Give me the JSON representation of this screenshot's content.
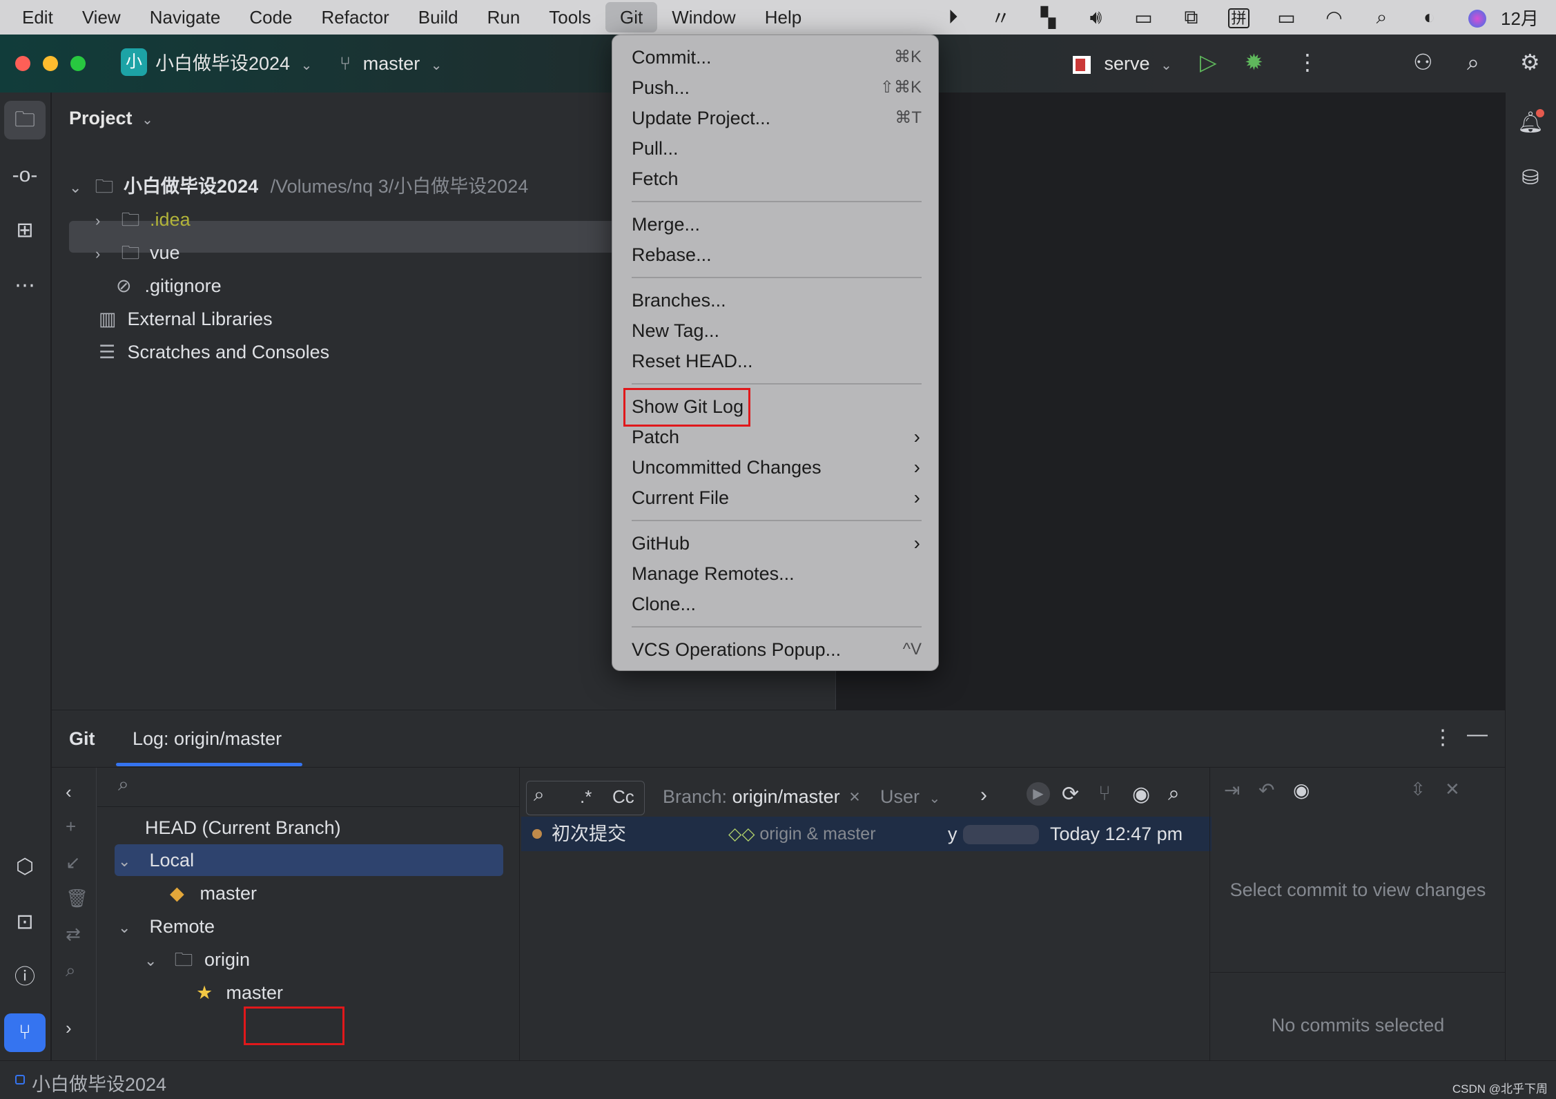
{
  "menubar": {
    "items": [
      "Edit",
      "View",
      "Navigate",
      "Code",
      "Refactor",
      "Build",
      "Run",
      "Tools",
      "Git",
      "Window",
      "Help"
    ],
    "active": "Git",
    "tray_icons": [
      "play-circle-icon",
      "signal-icon",
      "bookmark-icon",
      "volume-icon",
      "display-icon",
      "windows-icon",
      "input-method-icon",
      "battery-icon",
      "wifi-icon",
      "search-icon",
      "control-center-icon",
      "siri-icon"
    ],
    "input_method_glyph": "拼",
    "clock": "12月"
  },
  "toolbar": {
    "project_badge": "小",
    "project_name": "小白做毕设2024",
    "branch": "master",
    "run_config": "serve"
  },
  "project_panel": {
    "title": "Project",
    "root_name": "小白做毕设2024",
    "root_path": "/Volumes/nq 3/小白做毕设2024",
    "items": [
      ".idea",
      "vue",
      ".gitignore"
    ],
    "external_libraries": "External Libraries",
    "scratches": "Scratches and Consoles"
  },
  "git_menu": {
    "commit": "Commit...",
    "commit_sc": "⌘K",
    "push": "Push...",
    "push_sc": "⇧⌘K",
    "update": "Update Project...",
    "update_sc": "⌘T",
    "pull": "Pull...",
    "fetch": "Fetch",
    "merge": "Merge...",
    "rebase": "Rebase...",
    "branches": "Branches...",
    "new_tag": "New Tag...",
    "reset_head": "Reset HEAD...",
    "show_git_log": "Show Git Log",
    "patch": "Patch",
    "uncommitted": "Uncommitted Changes",
    "current_file": "Current File",
    "github": "GitHub",
    "manage_remotes": "Manage Remotes...",
    "clone": "Clone...",
    "vcs_popup": "VCS Operations Popup...",
    "vcs_popup_sc": "^V"
  },
  "git_window": {
    "tab_git": "Git",
    "tab_log": "Log: origin/master",
    "branches": {
      "head": "HEAD (Current Branch)",
      "local": "Local",
      "local_master": "master",
      "remote": "Remote",
      "origin": "origin",
      "origin_master": "master"
    },
    "filter": {
      "regex": ".*",
      "case": "Cc",
      "branch_label": "Branch:",
      "branch_value": "origin/master",
      "user": "User"
    },
    "commits": [
      {
        "message": "初次提交",
        "refs": "origin & master",
        "author": "y",
        "date": "Today 12:47 pm"
      }
    ],
    "details_placeholder": "Select commit to view changes",
    "no_commits": "No commits selected"
  },
  "status_bar": {
    "project": "小白做毕设2024",
    "watermark": "CSDN @北乎下周"
  },
  "colors": {
    "accent": "#3574f0",
    "highlight_box": "#e0181b",
    "idea_folder": "#b2b43a"
  }
}
